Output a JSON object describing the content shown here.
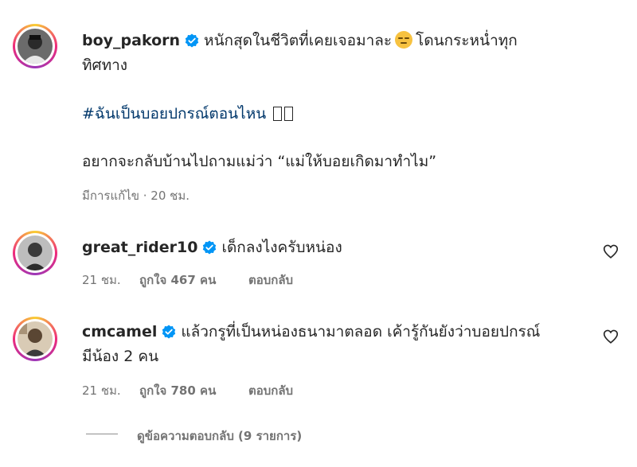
{
  "post": {
    "username": "boy_pakorn",
    "caption_line1_a": "หนักสุดในชีวิตที่เคยเจอมาละ",
    "caption_line1_b": "โดนกระหน่ำทุก",
    "caption_line2": "ทิศทาง",
    "hashtag": "#ฉันเป็นบอยปกรณ์ตอนไหน",
    "caption_line3": "อยากจะกลับบ้านไปถามแม่ว่า “แม่ให้บอยเกิดมาทำไม”",
    "meta": "มีการแก้ไข · 20 ชม.",
    "emoji_icon": "pensive-face-emoji"
  },
  "comments": [
    {
      "username": "great_rider10",
      "text_line1": "เด็กลงไงครับหน่อง",
      "time": "21 ชม.",
      "likes": "ถูกใจ 467 คน",
      "reply": "ตอบกลับ"
    },
    {
      "username": "cmcamel",
      "text_line1": "แล้วกรูที่เป็นหน่องธนามาตลอด เค้ารู้กันยังว่าบอยปกรณ์",
      "text_line2": "มีน้อง 2 คน",
      "time": "21 ชม.",
      "likes": "ถูกใจ 780 คน",
      "reply": "ตอบกลับ"
    }
  ],
  "view_replies": "ดูข้อความตอบกลับ (9 รายการ)",
  "colors": {
    "verified": "#0095f6",
    "hashtag": "#00376b",
    "meta": "#737373"
  }
}
